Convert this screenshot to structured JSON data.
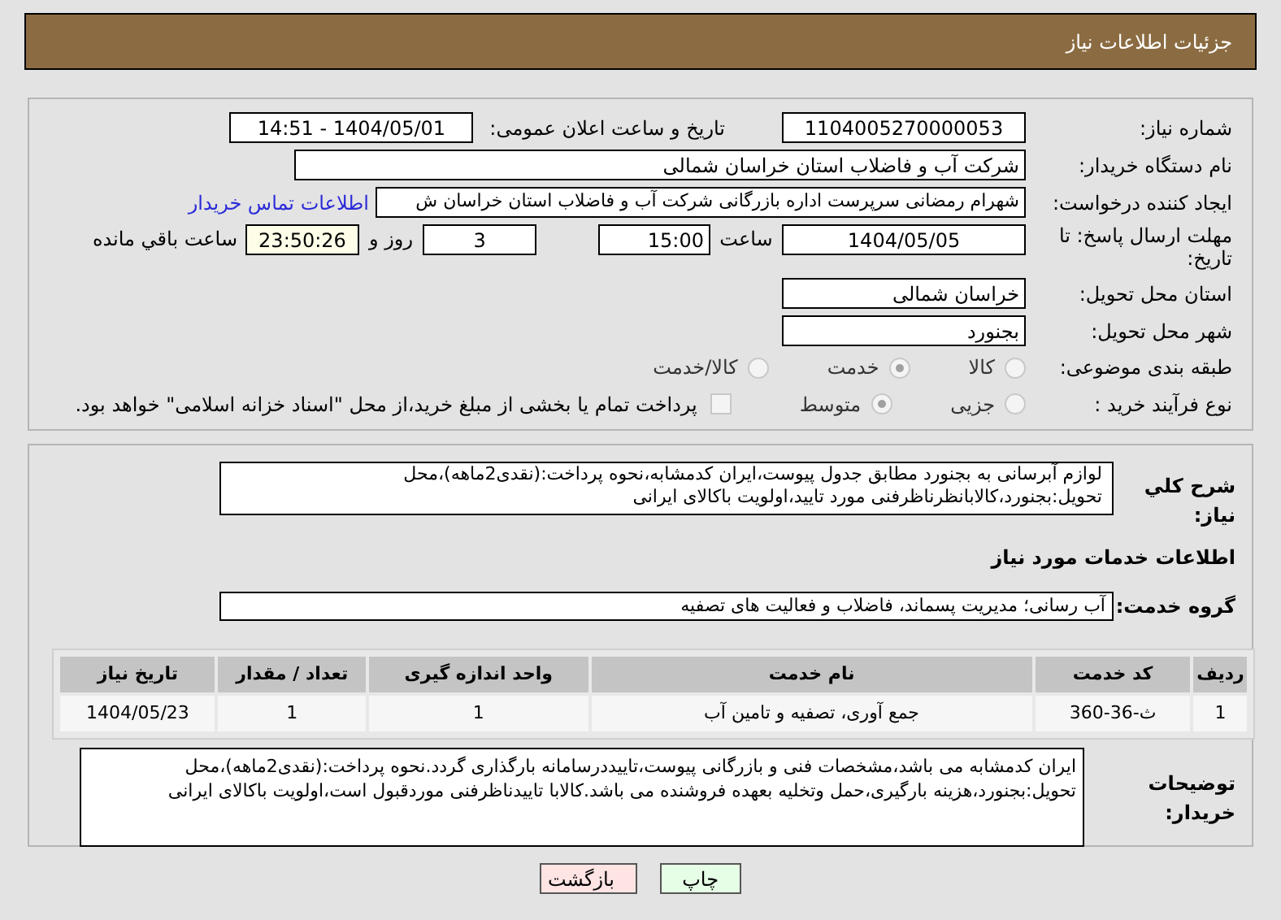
{
  "header": {
    "title": "جزئیات اطلاعات نیاز"
  },
  "details": {
    "need_number": {
      "label": "شماره نیاز:",
      "value": "1104005270000053"
    },
    "announce": {
      "label": "تاریخ و ساعت اعلان عمومی:",
      "value": "1404/05/01 - 14:51"
    },
    "buyer": {
      "label": "نام دستگاه خریدار:",
      "value": "شرکت آب و فاضلاب استان خراسان شمالی"
    },
    "requester": {
      "label": "ایجاد کننده درخواست:",
      "value": "شهرام رمضانی سرپرست اداره بازرگانی  شرکت آب و فاضلاب استان خراسان ش",
      "link": "اطلاعات تماس خریدار"
    },
    "deadline": {
      "label": "مهلت ارسال پاسخ: تا تاریخ:",
      "date": "1404/05/05",
      "time_label": "ساعت",
      "time": "15:00",
      "days": "3",
      "days_label": "روز و",
      "remaining": "23:50:26",
      "remaining_label": "ساعت باقي مانده"
    },
    "province": {
      "label": "استان محل تحویل:",
      "value": "خراسان شمالی"
    },
    "city": {
      "label": "شهر محل تحویل:",
      "value": "بجنورد"
    },
    "category": {
      "label": "طبقه بندی موضوعی:",
      "options": [
        {
          "label": "کالا",
          "selected": false
        },
        {
          "label": "خدمت",
          "selected": true
        },
        {
          "label": "کالا/خدمت",
          "selected": false
        }
      ]
    },
    "process": {
      "label": "نوع فرآیند خرید :",
      "options": [
        {
          "label": "جزیی",
          "selected": false
        },
        {
          "label": "متوسط",
          "selected": true
        }
      ],
      "treasury": {
        "checked": false,
        "text": "پرداخت تمام یا بخشی از مبلغ خرید،از محل \"اسناد خزانه اسلامی\" خواهد بود."
      }
    }
  },
  "description": {
    "label": "شرح کلي نياز:",
    "value": "لوازم آبرسانی به بجنورد مطابق جدول پیوست،ایران کدمشابه،نحوه پرداخت:(نقدی2ماهه)،محل تحویل:بجنورد،کالابانظرناظرفنی مورد تایید،اولویت باکالای ایرانی"
  },
  "services": {
    "title": "اطلاعات خدمات مورد نیاز",
    "group_label": "گروه خدمت:",
    "group": "آب رسانی؛ مدیریت پسماند، فاضلاب و فعالیت های تصفیه"
  },
  "table": {
    "columns": [
      "ردیف",
      "کد خدمت",
      "نام خدمت",
      "واحد اندازه گیری",
      "تعداد / مقدار",
      "تاریخ نیاز"
    ],
    "rows": [
      [
        "1",
        "ث-36-360",
        "جمع آوری، تصفیه و تامین آب",
        "1",
        "1",
        "1404/05/23"
      ]
    ]
  },
  "buyer_notes": {
    "label": "توضیحات خریدار:",
    "value": "ایران کدمشابه می باشد،مشخصات فنی و بازرگانی پیوست،تاییددرسامانه بارگذاری گردد.نحوه پرداخت:(نقدی2ماهه)،محل تحویل:بجنورد،هزینه بارگیری،حمل وتخلیه بعهده فروشنده می باشد.کالابا تاییدناظرفنی موردقبول است،اولویت باکالای ایرانی"
  },
  "buttons": [
    {
      "label": "چاپ",
      "kind": "print"
    },
    {
      "label": "بازگشت",
      "kind": "back"
    }
  ]
}
